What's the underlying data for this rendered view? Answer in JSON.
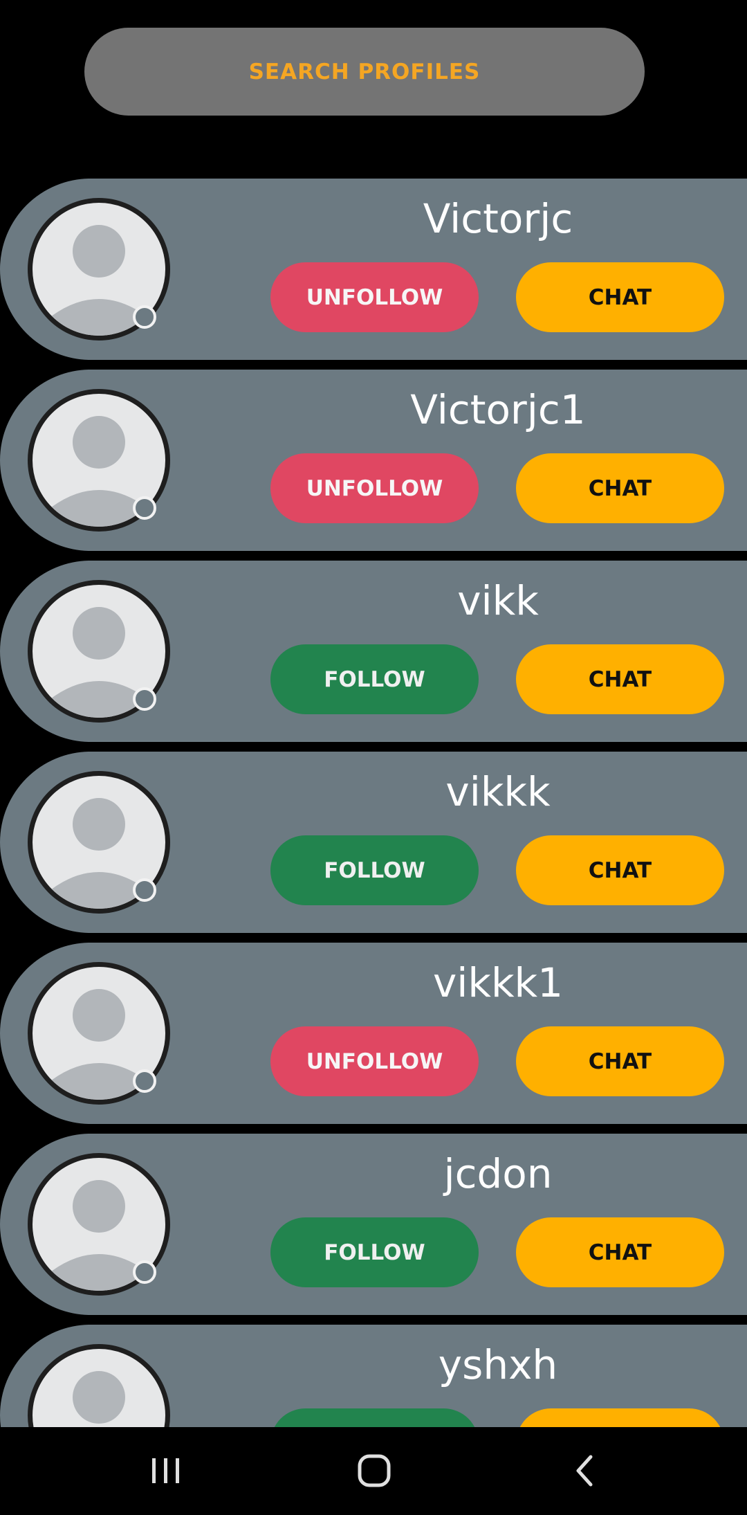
{
  "search": {
    "label": "SEARCH PROFILES"
  },
  "buttons": {
    "unfollow": "UNFOLLOW",
    "follow": "FOLLOW",
    "chat": "CHAT"
  },
  "colors": {
    "background": "#000000",
    "card": "#6C7A82",
    "search_bg": "#747474",
    "search_text": "#F5A623",
    "unfollow": "#E04762",
    "follow": "#22844E",
    "chat": "#FFB000"
  },
  "profiles": [
    {
      "username": "Victorjc",
      "following": true
    },
    {
      "username": "Victorjc1",
      "following": true
    },
    {
      "username": "vikk",
      "following": false
    },
    {
      "username": "vikkk",
      "following": false
    },
    {
      "username": "vikkk1",
      "following": true
    },
    {
      "username": "jcdon",
      "following": false
    },
    {
      "username": "yshxh",
      "following": false
    }
  ],
  "navbar": {
    "recents_icon": "recents-icon",
    "home_icon": "home-icon",
    "back_icon": "back-icon"
  }
}
